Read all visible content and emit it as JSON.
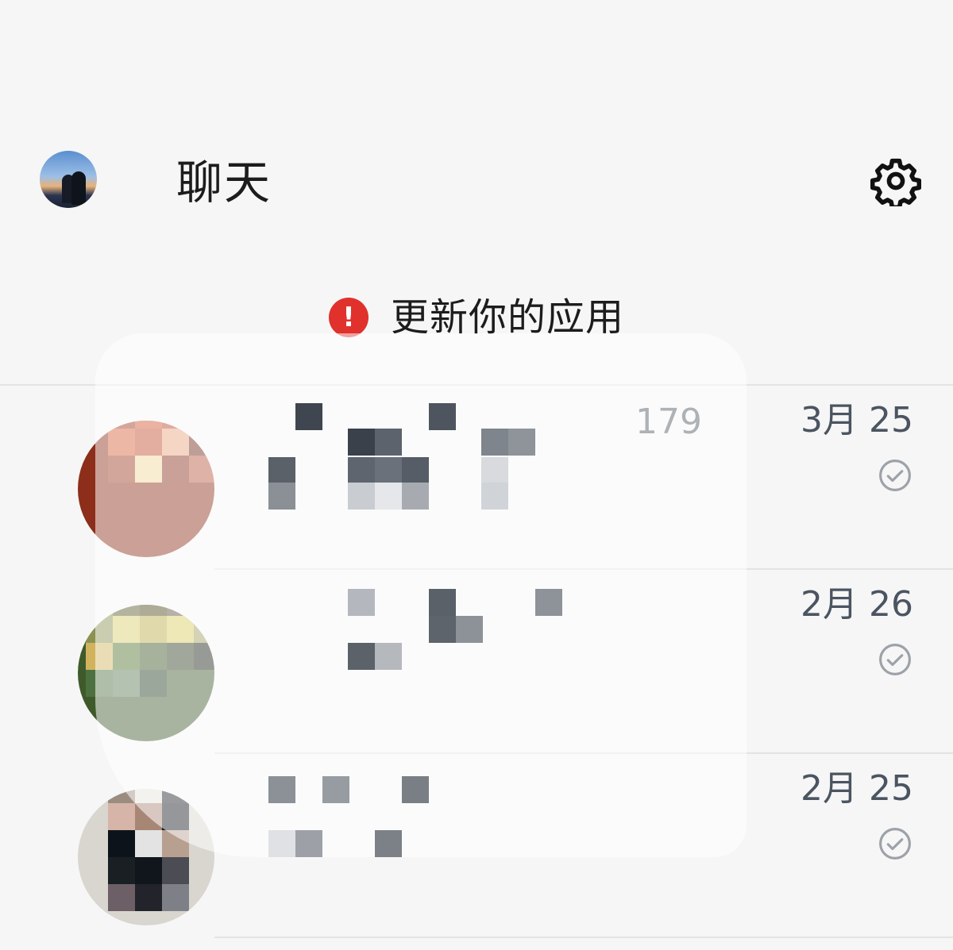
{
  "header": {
    "title": "聊天",
    "settings_icon": "gear-icon"
  },
  "banner": {
    "text": "更新你的应用",
    "icon": "alert-icon",
    "icon_glyph": "!",
    "icon_color": "#e0312c"
  },
  "chats": [
    {
      "date": "3月 25",
      "preview_fragment": "179",
      "status_icon": "read-check-icon",
      "avatar_palette": [
        "#a0391f",
        "#d35630",
        "#b8482b",
        "#7a2a18",
        "#d8603a",
        "#c24b2c",
        "#e9a27c",
        "#6d2a1a",
        "#9e3a22",
        "#f0d59a",
        "#8a2f1b",
        "#b5563d"
      ]
    },
    {
      "date": "2月 26",
      "preview_fragment": "",
      "status_icon": "read-check-icon",
      "avatar_palette": [
        "#7b9043",
        "#5a5c2b",
        "#4c4519",
        "#5d5140",
        "#7b6f5b",
        "#8b9150",
        "#d7cf6c",
        "#b9ab47",
        "#d9c95e",
        "#a39e5e",
        "#d1b35e",
        "#50712c",
        "#3c5526",
        "#2f3d22",
        "#1b2214",
        "#4d7040",
        "#5a7856",
        "#213c1f"
      ]
    },
    {
      "date": "2月 25",
      "preview_fragment": "",
      "status_icon": "read-check-icon",
      "avatar_palette": [
        "#9c8c80",
        "#e6e2da",
        "#1f222a",
        "#d6b4a8",
        "#a88676",
        "#151a20",
        "#0d131b",
        "#e3e3e3",
        "#b8a090",
        "#1a1f24",
        "#10161c",
        "#4c4c55",
        "#6c5f66",
        "#23242b",
        "#7d8086"
      ]
    }
  ],
  "colors": {
    "background": "#f6f6f6",
    "date_text": "#4b5561",
    "check_icon": "#9da2a8"
  }
}
